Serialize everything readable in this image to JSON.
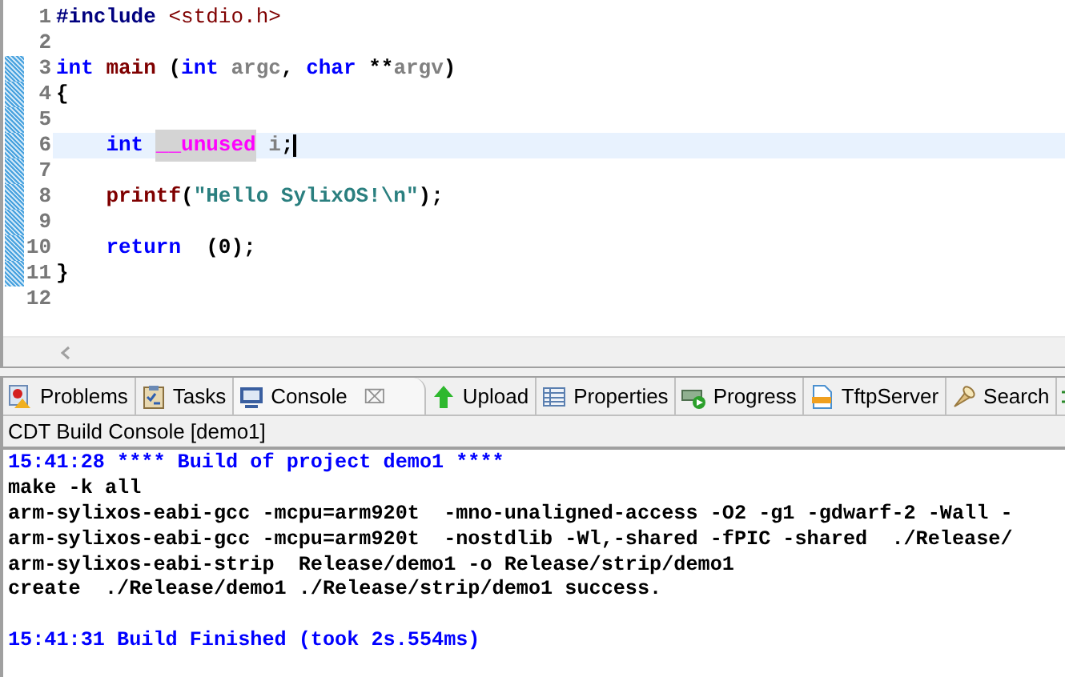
{
  "editor": {
    "lines": [
      {
        "number": "1",
        "changed": false,
        "current": false,
        "tokens": [
          {
            "text": "#include",
            "kind": "directive"
          },
          {
            "text": " <stdio.h>",
            "kind": "header"
          }
        ]
      },
      {
        "number": "2",
        "changed": false,
        "current": false
      },
      {
        "number": "3",
        "changed": true,
        "current": false,
        "tokens": [
          {
            "text": "int",
            "kind": "keyword"
          },
          {
            "text": " main",
            "kind": "function"
          },
          {
            "text": " (",
            "kind": "plain"
          },
          {
            "text": "int",
            "kind": "keyword"
          },
          {
            "text": " argc",
            "kind": "param"
          },
          {
            "text": ", ",
            "kind": "plain"
          },
          {
            "text": "char",
            "kind": "keyword"
          },
          {
            "text": " **",
            "kind": "plain"
          },
          {
            "text": "argv",
            "kind": "param"
          },
          {
            "text": ")",
            "kind": "plain"
          }
        ]
      },
      {
        "number": "4",
        "changed": true,
        "current": false,
        "tokens": [
          {
            "text": "{",
            "kind": "plain"
          }
        ]
      },
      {
        "number": "5",
        "changed": true,
        "current": false
      },
      {
        "number": "6",
        "changed": true,
        "current": true,
        "tokens": [
          {
            "text": "    int ",
            "kind": "keyword"
          },
          {
            "text": "__unused",
            "kind": "macro"
          },
          {
            "text": " i",
            "kind": "param"
          },
          {
            "text": ";",
            "kind": "plain"
          }
        ]
      },
      {
        "number": "7",
        "changed": true,
        "current": false
      },
      {
        "number": "8",
        "changed": true,
        "current": false,
        "tokens": [
          {
            "text": "    printf",
            "kind": "function"
          },
          {
            "text": "(",
            "kind": "plain"
          },
          {
            "text": "\"Hello SylixOS!\\n\"",
            "kind": "string"
          },
          {
            "text": ");",
            "kind": "plain"
          }
        ]
      },
      {
        "number": "9",
        "changed": true,
        "current": false
      },
      {
        "number": "10",
        "changed": true,
        "current": false,
        "tokens": [
          {
            "text": "    return",
            "kind": "keyword"
          },
          {
            "text": "  (0);",
            "kind": "plain"
          }
        ]
      },
      {
        "number": "11",
        "changed": true,
        "current": false,
        "tokens": [
          {
            "text": "}",
            "kind": "plain"
          }
        ]
      },
      {
        "number": "12",
        "changed": false,
        "current": false
      }
    ]
  },
  "tabs": [
    {
      "label": "Problems",
      "selected": false
    },
    {
      "label": "Tasks",
      "selected": false
    },
    {
      "label": "Console",
      "selected": true,
      "close": "⌧"
    },
    {
      "label": "Upload",
      "selected": false
    },
    {
      "label": "Properties",
      "selected": false
    },
    {
      "label": "Progress",
      "selected": false
    },
    {
      "label": "TftpServer",
      "selected": false
    },
    {
      "label": "Search",
      "selected": false
    }
  ],
  "console": {
    "title": "CDT Build Console [demo1]",
    "lines": [
      {
        "text": "15:41:28 **** Build of project demo1 ****",
        "kind": "info"
      },
      {
        "text": "make -k all",
        "kind": "output"
      },
      {
        "text": "arm-sylixos-eabi-gcc -mcpu=arm920t  -mno-unaligned-access -O2 -g1 -gdwarf-2 -Wall -",
        "kind": "output"
      },
      {
        "text": "arm-sylixos-eabi-gcc -mcpu=arm920t  -nostdlib -Wl,-shared -fPIC -shared  ./Release/",
        "kind": "output"
      },
      {
        "text": "arm-sylixos-eabi-strip  Release/demo1 -o Release/strip/demo1",
        "kind": "output"
      },
      {
        "text": "create  ./Release/demo1 ./Release/strip/demo1 success.",
        "kind": "output"
      },
      {
        "kind": "blank"
      },
      {
        "text": "15:41:31 Build Finished (took 2s.554ms)",
        "kind": "info"
      }
    ]
  }
}
